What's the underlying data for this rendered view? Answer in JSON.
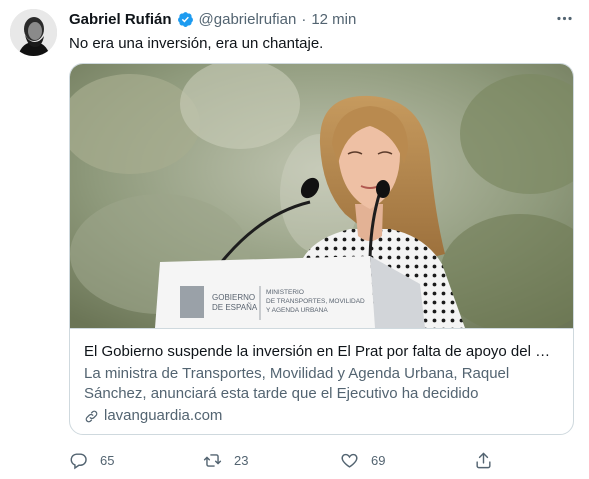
{
  "author": {
    "name": "Gabriel Rufián",
    "handle": "@gabrielrufian",
    "separator": "·",
    "time": "12 min",
    "verified": true,
    "avatar_icon": "profile-photo"
  },
  "tweet": {
    "text": "No era una inversión, era un chantaje."
  },
  "card": {
    "image": {
      "podium_sign_line1": "GOBIERNO",
      "podium_sign_line2": "DE ESPAÑA",
      "podium_sign_line3": "MINISTERIO",
      "podium_sign_line4": "DE TRANSPORTES, MOVILIDAD",
      "podium_sign_line5": "Y AGENDA URBANA"
    },
    "title": "El Gobierno suspende la inversión en El Prat  por falta de apoyo del G…",
    "description": "La ministra de Transportes, Movilidad y Agenda Urbana, Raquel Sánchez, anunciará esta tarde que el Ejecutivo ha decidido suspender…",
    "domain": "lavanguardia.com",
    "domain_icon": "link-icon"
  },
  "actions": {
    "reply_count": "65",
    "retweet_count": "23",
    "like_count": "69",
    "share_icon": "share-icon"
  },
  "colors": {
    "text": "#0f1419",
    "muted": "#536471",
    "border": "#cfd9de",
    "verified": "#1d9bf0"
  }
}
